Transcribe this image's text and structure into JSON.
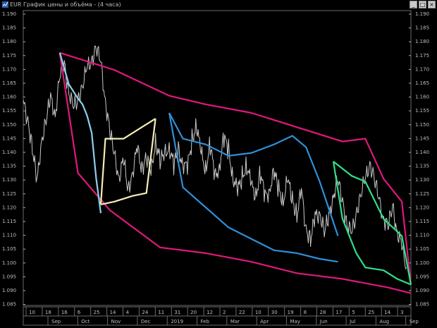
{
  "window": {
    "title": "EUR График цены и объёма - (4 часа)",
    "buttons": [
      "_",
      "□",
      "×"
    ]
  },
  "colors": {
    "background": "#000000",
    "price": "#c8c8c8",
    "outer_channel": "#e0187a",
    "blue_channel": "#2f8fd8",
    "light_blue_channel": "#8fd0f0",
    "yellow_channel": "#f4efb4",
    "green_channel": "#2fe08a",
    "axis": "#b0b0b0"
  },
  "chart_data": {
    "type": "line",
    "title": "",
    "ylim": [
      1.087,
      1.19
    ],
    "yticks": [
      "1.190",
      "1.185",
      "1.180",
      "1.175",
      "1.170",
      "1.165",
      "1.160",
      "1.155",
      "1.150",
      "1.145",
      "1.140",
      "1.135",
      "1.130",
      "1.125",
      "1.120",
      "1.115",
      "1.110",
      "1.105",
      "1.100",
      "1.095",
      "1.090",
      "1.085"
    ],
    "x_days": [
      "10",
      "18",
      "16",
      "6",
      "25",
      "14",
      "4",
      "24",
      "11",
      "31",
      "20",
      "12",
      "2",
      "22",
      "10",
      "30",
      "19",
      "8",
      "28",
      "17",
      "5",
      "25",
      "14",
      "3"
    ],
    "x_months": [
      "Sep",
      "Oct",
      "Nov",
      "Dec",
      "2019",
      "Feb",
      "Mar",
      "Apr",
      "May",
      "Jun",
      "Jul",
      "Aug",
      "Sep"
    ],
    "series": [
      {
        "key": "price",
        "points": [
          [
            0,
            1.158
          ],
          [
            2,
            1.153
          ],
          [
            4,
            1.143
          ],
          [
            6,
            1.13
          ],
          [
            8,
            1.146
          ],
          [
            10,
            1.152
          ],
          [
            12,
            1.16
          ],
          [
            14,
            1.155
          ],
          [
            16,
            1.167
          ],
          [
            18,
            1.172
          ],
          [
            20,
            1.163
          ],
          [
            22,
            1.156
          ],
          [
            24,
            1.16
          ],
          [
            26,
            1.165
          ],
          [
            28,
            1.17
          ],
          [
            30,
            1.174
          ],
          [
            32,
            1.178
          ],
          [
            34,
            1.172
          ],
          [
            36,
            1.16
          ],
          [
            38,
            1.148
          ],
          [
            40,
            1.14
          ],
          [
            42,
            1.133
          ],
          [
            44,
            1.138
          ],
          [
            46,
            1.128
          ],
          [
            48,
            1.135
          ],
          [
            50,
            1.142
          ],
          [
            52,
            1.136
          ],
          [
            54,
            1.14
          ],
          [
            56,
            1.133
          ],
          [
            58,
            1.146
          ],
          [
            60,
            1.138
          ],
          [
            62,
            1.14
          ],
          [
            64,
            1.144
          ],
          [
            66,
            1.136
          ],
          [
            68,
            1.142
          ],
          [
            70,
            1.138
          ],
          [
            72,
            1.135
          ],
          [
            74,
            1.146
          ],
          [
            76,
            1.151
          ],
          [
            78,
            1.14
          ],
          [
            80,
            1.136
          ],
          [
            82,
            1.144
          ],
          [
            84,
            1.132
          ],
          [
            86,
            1.137
          ],
          [
            88,
            1.146
          ],
          [
            90,
            1.142
          ],
          [
            92,
            1.133
          ],
          [
            94,
            1.127
          ],
          [
            96,
            1.133
          ],
          [
            98,
            1.137
          ],
          [
            100,
            1.129
          ],
          [
            102,
            1.127
          ],
          [
            104,
            1.134
          ],
          [
            106,
            1.125
          ],
          [
            108,
            1.129
          ],
          [
            110,
            1.134
          ],
          [
            112,
            1.128
          ],
          [
            114,
            1.125
          ],
          [
            116,
            1.131
          ],
          [
            118,
            1.125
          ],
          [
            120,
            1.12
          ],
          [
            122,
            1.127
          ],
          [
            124,
            1.115
          ],
          [
            126,
            1.111
          ],
          [
            128,
            1.118
          ],
          [
            130,
            1.121
          ],
          [
            132,
            1.113
          ],
          [
            134,
            1.118
          ],
          [
            136,
            1.127
          ],
          [
            138,
            1.131
          ],
          [
            140,
            1.124
          ],
          [
            142,
            1.117
          ],
          [
            144,
            1.112
          ],
          [
            146,
            1.12
          ],
          [
            148,
            1.127
          ],
          [
            150,
            1.131
          ],
          [
            152,
            1.138
          ],
          [
            154,
            1.132
          ],
          [
            156,
            1.124
          ],
          [
            158,
            1.119
          ],
          [
            160,
            1.115
          ],
          [
            162,
            1.122
          ],
          [
            164,
            1.114
          ],
          [
            166,
            1.108
          ],
          [
            168,
            1.101
          ]
        ]
      },
      {
        "key": "outer_upper",
        "points": [
          [
            16,
            1.176
          ],
          [
            40,
            1.17
          ],
          [
            64,
            1.161
          ],
          [
            80,
            1.158
          ],
          [
            100,
            1.155
          ],
          [
            120,
            1.15
          ],
          [
            140,
            1.145
          ],
          [
            150,
            1.146
          ],
          [
            158,
            1.132
          ],
          [
            166,
            1.124
          ],
          [
            170,
            1.095
          ]
        ]
      },
      {
        "key": "outer_lower",
        "points": [
          [
            16,
            1.176
          ],
          [
            24,
            1.134
          ],
          [
            38,
            1.121
          ],
          [
            60,
            1.108
          ],
          [
            80,
            1.106
          ],
          [
            100,
            1.103
          ],
          [
            120,
            1.099
          ],
          [
            140,
            1.097
          ],
          [
            160,
            1.094
          ],
          [
            170,
            1.092
          ]
        ]
      },
      {
        "key": "blue_upper",
        "points": [
          [
            64,
            1.155
          ],
          [
            70,
            1.146
          ],
          [
            80,
            1.144
          ],
          [
            90,
            1.14
          ],
          [
            100,
            1.141
          ],
          [
            110,
            1.144
          ],
          [
            118,
            1.147
          ],
          [
            124,
            1.143
          ],
          [
            130,
            1.131
          ],
          [
            138,
            1.112
          ]
        ]
      },
      {
        "key": "blue_lower",
        "points": [
          [
            64,
            1.155
          ],
          [
            70,
            1.129
          ],
          [
            80,
            1.122
          ],
          [
            90,
            1.115
          ],
          [
            100,
            1.111
          ],
          [
            110,
            1.107
          ],
          [
            120,
            1.106
          ],
          [
            130,
            1.104
          ],
          [
            138,
            1.103
          ]
        ]
      },
      {
        "key": "light_blue",
        "points": [
          [
            16,
            1.176
          ],
          [
            20,
            1.165
          ],
          [
            24,
            1.16
          ],
          [
            26,
            1.158
          ],
          [
            28,
            1.154
          ],
          [
            30,
            1.148
          ],
          [
            32,
            1.132
          ],
          [
            34,
            1.12
          ]
        ]
      },
      {
        "key": "yellow_upper",
        "points": [
          [
            34,
            1.123
          ],
          [
            36,
            1.146
          ],
          [
            44,
            1.146
          ],
          [
            52,
            1.15
          ],
          [
            58,
            1.153
          ]
        ]
      },
      {
        "key": "yellow_lower",
        "points": [
          [
            34,
            1.123
          ],
          [
            40,
            1.124
          ],
          [
            48,
            1.126
          ],
          [
            54,
            1.127
          ],
          [
            58,
            1.153
          ]
        ]
      },
      {
        "key": "green_upper",
        "points": [
          [
            136,
            1.138
          ],
          [
            144,
            1.133
          ],
          [
            150,
            1.131
          ],
          [
            158,
            1.118
          ],
          [
            166,
            1.112
          ],
          [
            170,
            1.095
          ]
        ]
      },
      {
        "key": "green_lower",
        "points": [
          [
            136,
            1.138
          ],
          [
            140,
            1.118
          ],
          [
            146,
            1.106
          ],
          [
            150,
            1.101
          ],
          [
            158,
            1.1
          ],
          [
            164,
            1.097
          ],
          [
            170,
            1.095
          ]
        ]
      }
    ]
  }
}
